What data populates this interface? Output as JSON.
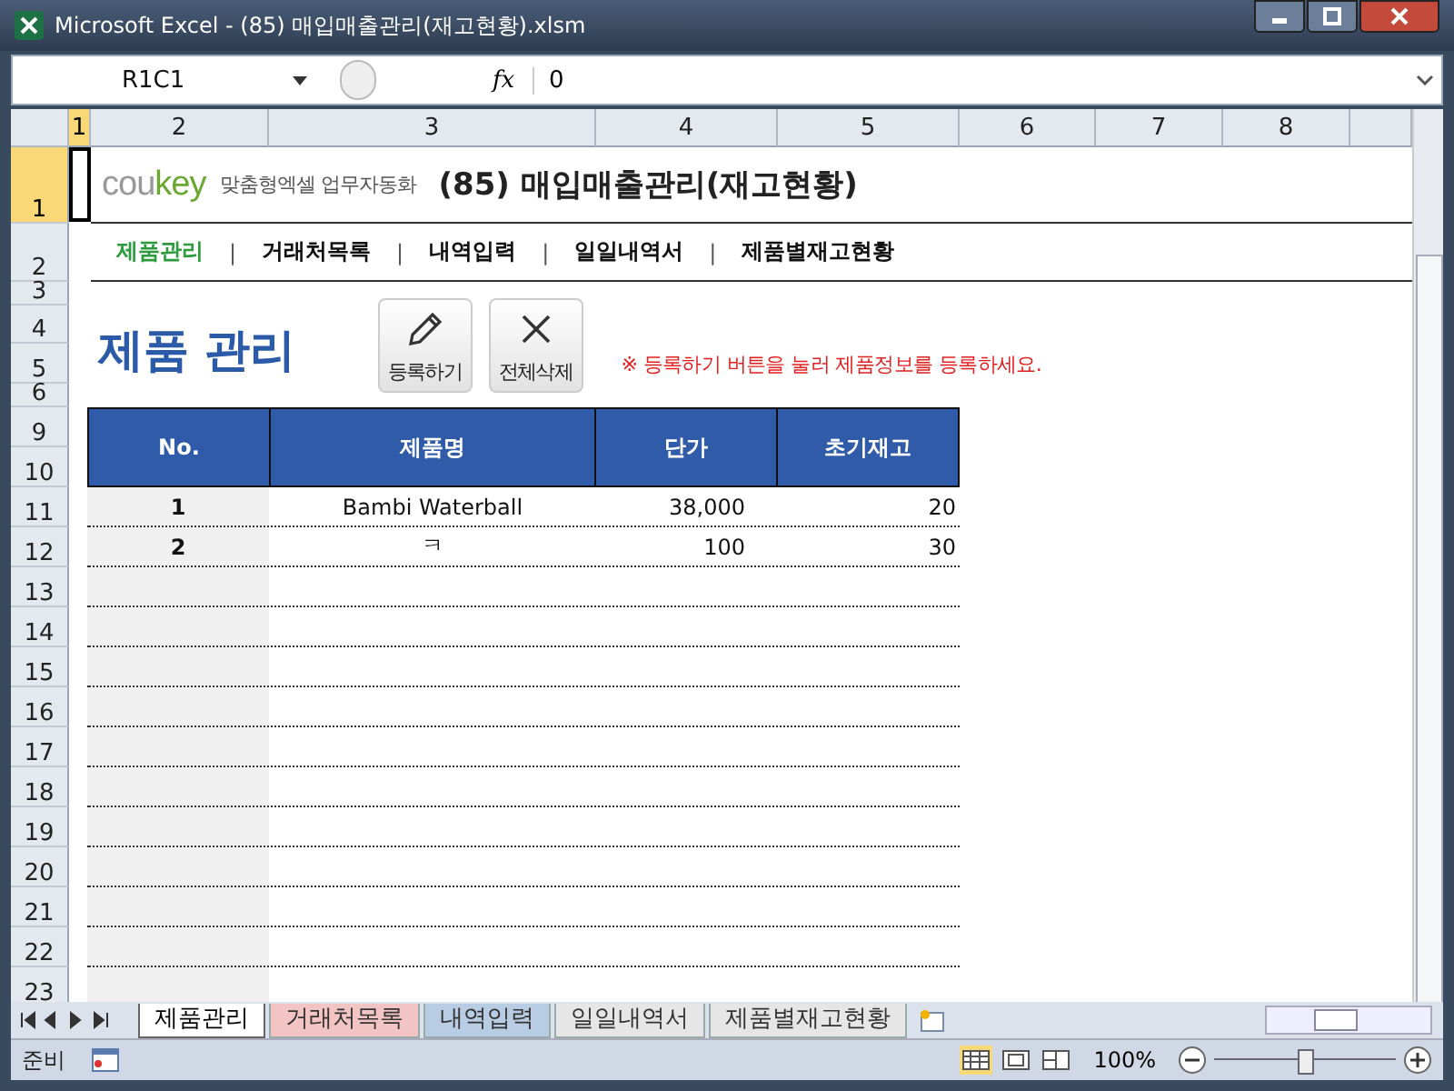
{
  "window": {
    "title": "Microsoft Excel - (85) 매입매출관리(재고현황).xlsm"
  },
  "formula_bar": {
    "name_box": "R1C1",
    "fx": "fx",
    "value": "0"
  },
  "column_headers": [
    {
      "label": "1",
      "selected": true
    },
    {
      "label": "2",
      "selected": false
    },
    {
      "label": "3",
      "selected": false
    },
    {
      "label": "4",
      "selected": false
    },
    {
      "label": "5",
      "selected": false
    },
    {
      "label": "6",
      "selected": false
    },
    {
      "label": "7",
      "selected": false
    },
    {
      "label": "8",
      "selected": false
    }
  ],
  "row_headers": [
    {
      "label": "1",
      "selected": true
    },
    {
      "label": "2",
      "selected": false
    },
    {
      "label": "3",
      "selected": false
    },
    {
      "label": "4",
      "selected": false
    },
    {
      "label": "5",
      "selected": false
    },
    {
      "label": "6",
      "selected": false
    },
    {
      "label": "9",
      "selected": false
    },
    {
      "label": "10",
      "selected": false
    },
    {
      "label": "11",
      "selected": false
    },
    {
      "label": "12",
      "selected": false
    },
    {
      "label": "13",
      "selected": false
    },
    {
      "label": "14",
      "selected": false
    },
    {
      "label": "15",
      "selected": false
    },
    {
      "label": "16",
      "selected": false
    },
    {
      "label": "17",
      "selected": false
    },
    {
      "label": "18",
      "selected": false
    },
    {
      "label": "19",
      "selected": false
    },
    {
      "label": "20",
      "selected": false
    },
    {
      "label": "21",
      "selected": false
    },
    {
      "label": "22",
      "selected": false
    },
    {
      "label": "23",
      "selected": false
    }
  ],
  "banner": {
    "logo_gray": "cou",
    "logo_green": "key",
    "tagline": "맞춤형엑셀 업무자동화",
    "title": "(85) 매입매출관리(재고현황)"
  },
  "nav": [
    {
      "label": "제품관리",
      "selected": true
    },
    {
      "label": "거래처목록",
      "selected": false
    },
    {
      "label": "내역입력",
      "selected": false
    },
    {
      "label": "일일내역서",
      "selected": false
    },
    {
      "label": "제품별재고현황",
      "selected": false
    }
  ],
  "nav_separator": "|",
  "heading": "제품 관리",
  "buttons": [
    {
      "label": "등록하기",
      "kind": "pencil"
    },
    {
      "label": "전체삭제",
      "kind": "cross"
    }
  ],
  "notice": "※ 등록하기 버튼을 눌러 제품정보를 등록하세요.",
  "table": {
    "columns": [
      "No.",
      "제품명",
      "단가",
      "초기재고"
    ],
    "rows": [
      [
        "1",
        "Bambi Waterball",
        "38,000",
        "20"
      ],
      [
        "2",
        "ㅋ",
        "100",
        "30"
      ]
    ]
  },
  "sheet_tabs": [
    {
      "label": "제품관리",
      "selected": true,
      "color": "#ffffff"
    },
    {
      "label": "거래처목록",
      "selected": false,
      "color": "#f2c4c4"
    },
    {
      "label": "내역입력",
      "selected": false,
      "color": "#b8cce4"
    },
    {
      "label": "일일내역서",
      "selected": false,
      "color": "#e6e6e6"
    },
    {
      "label": "제품별재고현황",
      "selected": false,
      "color": "#e6e6e6"
    }
  ],
  "status_bar": {
    "status": "준비",
    "zoom": "100%",
    "level": 0.5
  }
}
